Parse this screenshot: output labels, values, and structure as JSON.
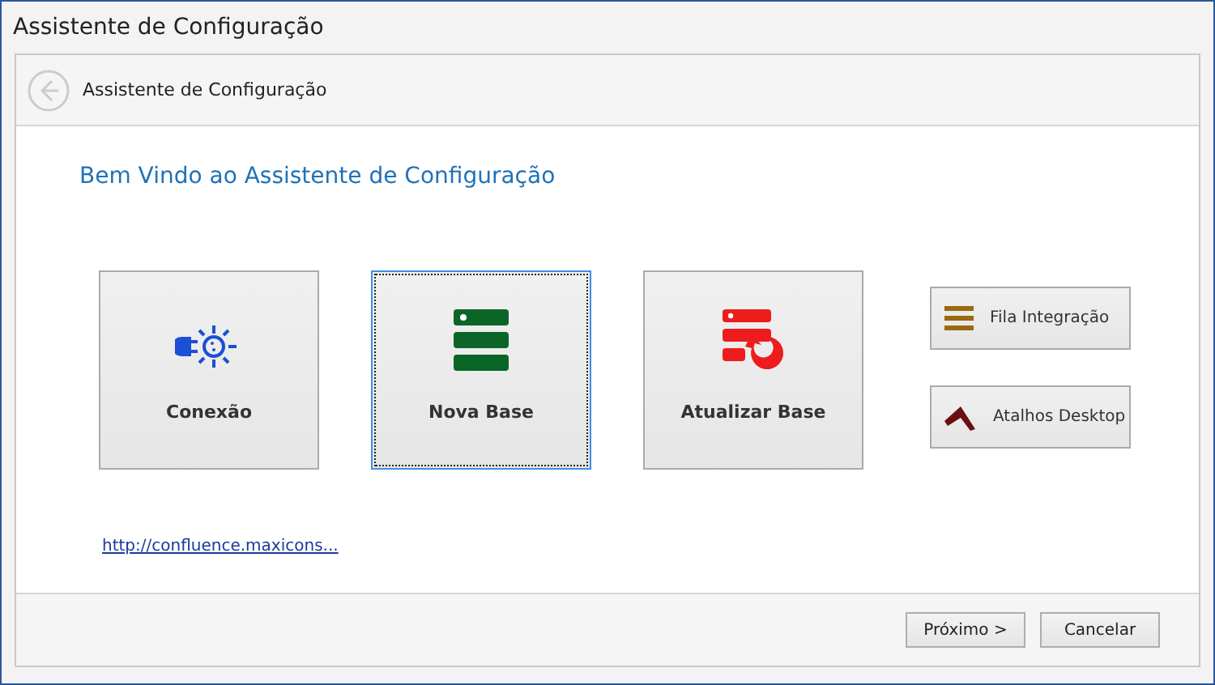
{
  "window": {
    "title": "Assistente de Configuração"
  },
  "header": {
    "title": "Assistente de Configuração"
  },
  "heading": "Bem Vindo ao Assistente de Configuração",
  "tiles": [
    {
      "label": "Conexão",
      "kind": "connection",
      "selected": false
    },
    {
      "label": "Nova Base",
      "kind": "database",
      "selected": true
    },
    {
      "label": "Atualizar Base",
      "kind": "update",
      "selected": false
    }
  ],
  "side_buttons": [
    {
      "label": "Fila Integração",
      "kind": "queue"
    },
    {
      "label": "Atalhos Desktop",
      "kind": "shortcut"
    }
  ],
  "link": "http://confluence.maxicons...",
  "buttons": [
    "Próximo >",
    "Cancelar"
  ]
}
